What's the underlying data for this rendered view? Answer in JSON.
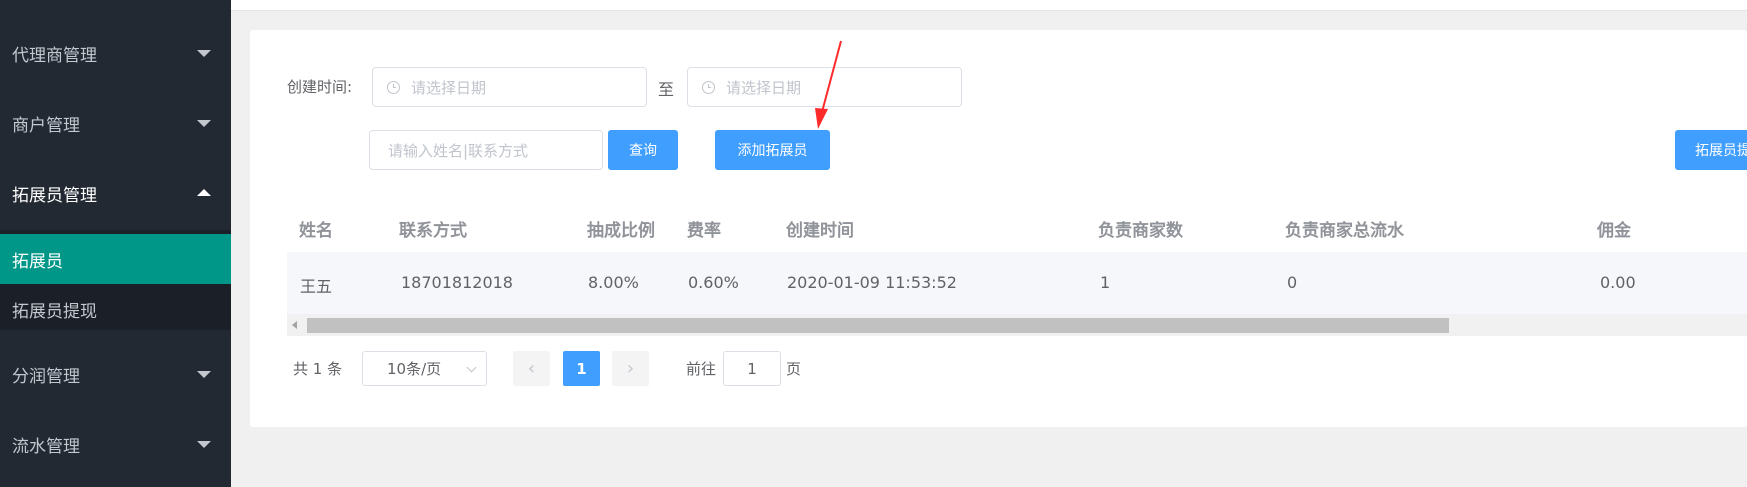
{
  "sidebar": {
    "groups": [
      {
        "label": "代理商管理"
      },
      {
        "label": "商户管理"
      },
      {
        "label": "拓展员管理"
      },
      {
        "label": "分润管理"
      },
      {
        "label": "流水管理"
      }
    ],
    "submenu": [
      {
        "label": "拓展员"
      },
      {
        "label": "拓展员提现"
      }
    ]
  },
  "filters": {
    "created_label": "创建时间:",
    "start_placeholder": "请选择日期",
    "to_label": "至",
    "end_placeholder": "请选择日期",
    "name_placeholder": "请输入姓名|联系方式",
    "query_label": "查询",
    "add_label": "添加拓展员",
    "right_button_label": "拓展员提"
  },
  "table": {
    "columns": [
      "姓名",
      "联系方式",
      "抽成比例",
      "费率",
      "创建时间",
      "负责商家数",
      "负责商家总流水",
      "佣金"
    ],
    "rows": [
      [
        "王五",
        "18701812018",
        "8.00%",
        "0.60%",
        "2020-01-09 11:53:52",
        "1",
        "0",
        "0.00"
      ]
    ]
  },
  "pagination": {
    "total": "共 1 条",
    "page_size": "10条/页",
    "prev": "‹",
    "current": "1",
    "next": "›",
    "goto_prefix": "前往",
    "goto_value": "1",
    "goto_suffix": "页"
  },
  "colors": {
    "sidebar_bg": "#222933",
    "active_item": "#009688",
    "primary": "#409eff",
    "annotation": "#ff2a2a"
  }
}
